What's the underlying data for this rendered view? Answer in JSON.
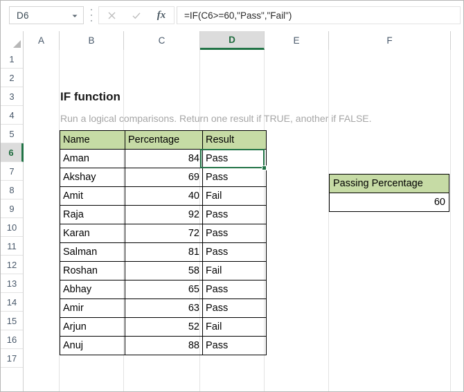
{
  "formula_bar": {
    "name_box_value": "D6",
    "name_box_dropdown_icon": "chevron-down-icon",
    "cancel_icon": "close-icon",
    "confirm_icon": "check-icon",
    "function_icon": "fx-icon",
    "function_icon_label": "fx",
    "formula_value": "=IF(C6>=60,\"Pass\",\"Fail\")"
  },
  "grid": {
    "columns": [
      "A",
      "B",
      "C",
      "D",
      "E",
      "F"
    ],
    "selected_column": "D",
    "rows": [
      "1",
      "2",
      "3",
      "4",
      "5",
      "6",
      "7",
      "8",
      "9",
      "10",
      "11",
      "12",
      "13",
      "14",
      "15",
      "16",
      "17"
    ],
    "selected_row": "6"
  },
  "sheet": {
    "title": "IF function",
    "subtitle": "Run a logical comparisons. Return one result if TRUE, another if FALSE.",
    "table": {
      "headers": [
        "Name",
        "Percentage",
        "Result"
      ],
      "rows": [
        [
          "Aman",
          "84",
          "Pass"
        ],
        [
          "Akshay",
          "69",
          "Pass"
        ],
        [
          "Amit",
          "40",
          "Fail"
        ],
        [
          "Raja",
          "92",
          "Pass"
        ],
        [
          "Karan",
          "72",
          "Pass"
        ],
        [
          "Salman",
          "81",
          "Pass"
        ],
        [
          "Roshan",
          "58",
          "Fail"
        ],
        [
          "Abhay",
          "65",
          "Pass"
        ],
        [
          "Amir",
          "63",
          "Pass"
        ],
        [
          "Arjun",
          "52",
          "Fail"
        ],
        [
          "Anuj",
          "88",
          "Pass"
        ]
      ]
    },
    "side_box": {
      "header": "Passing Percentage",
      "value": "60"
    }
  },
  "colors": {
    "header_fill": "#c6dba5",
    "selection_green": "#217346",
    "header_selected_bg": "#dcdcdc",
    "subtitle_gray": "#a6a6a6"
  }
}
